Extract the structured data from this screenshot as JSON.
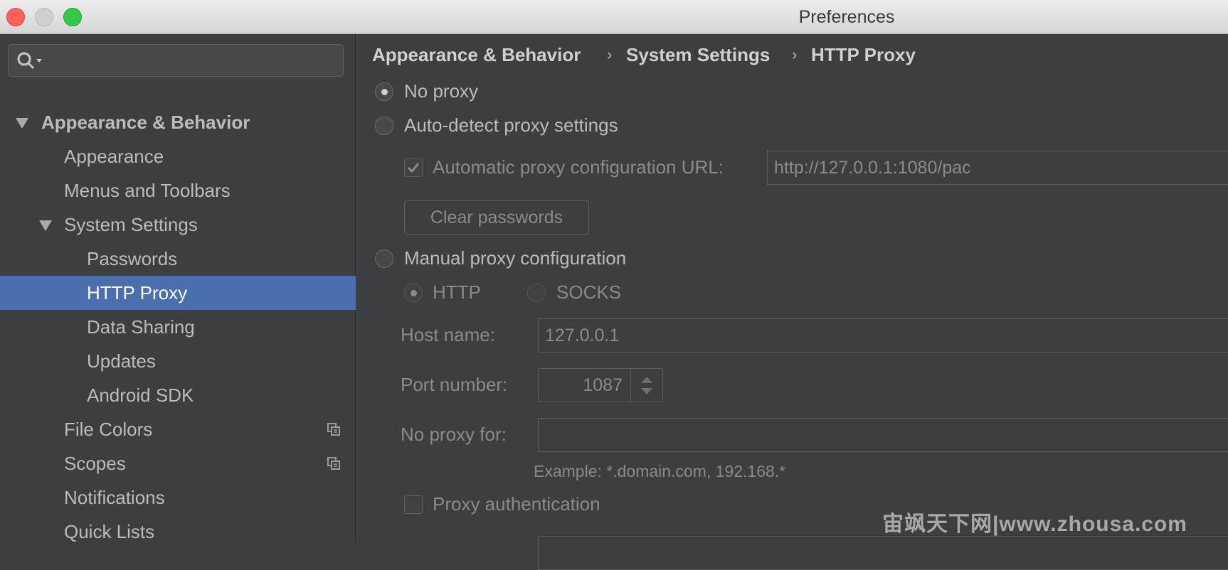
{
  "window": {
    "title": "Preferences"
  },
  "sidebar": {
    "search_placeholder": "",
    "items": [
      {
        "label": "Appearance & Behavior"
      },
      {
        "label": "Appearance"
      },
      {
        "label": "Menus and Toolbars"
      },
      {
        "label": "System Settings"
      },
      {
        "label": "Passwords"
      },
      {
        "label": "HTTP Proxy"
      },
      {
        "label": "Data Sharing"
      },
      {
        "label": "Updates"
      },
      {
        "label": "Android SDK"
      },
      {
        "label": "File Colors"
      },
      {
        "label": "Scopes"
      },
      {
        "label": "Notifications"
      },
      {
        "label": "Quick Lists"
      }
    ]
  },
  "breadcrumb": [
    "Appearance & Behavior",
    "System Settings",
    "HTTP Proxy"
  ],
  "breadcrumb_separator": "›",
  "proxy": {
    "no_proxy_label": "No proxy",
    "auto_detect_label": "Auto-detect proxy settings",
    "auto_config_url_label": "Automatic proxy configuration URL:",
    "auto_config_url_value": "http://127.0.0.1:1080/pac",
    "clear_passwords_label": "Clear passwords",
    "manual_label": "Manual proxy configuration",
    "http_label": "HTTP",
    "socks_label": "SOCKS",
    "host_name_label": "Host name:",
    "host_name_value": "127.0.0.1",
    "port_number_label": "Port number:",
    "port_number_value": "1087",
    "no_proxy_for_label": "No proxy for:",
    "no_proxy_for_value": "",
    "example_text": "Example: *.domain.com, 192.168.*",
    "proxy_auth_label": "Proxy authentication",
    "selected_mode": "No proxy"
  },
  "watermark": "宙飒天下网|www.zhousa.com",
  "colors": {
    "selection": "#4b6eaf",
    "background": "#3c3f41"
  }
}
